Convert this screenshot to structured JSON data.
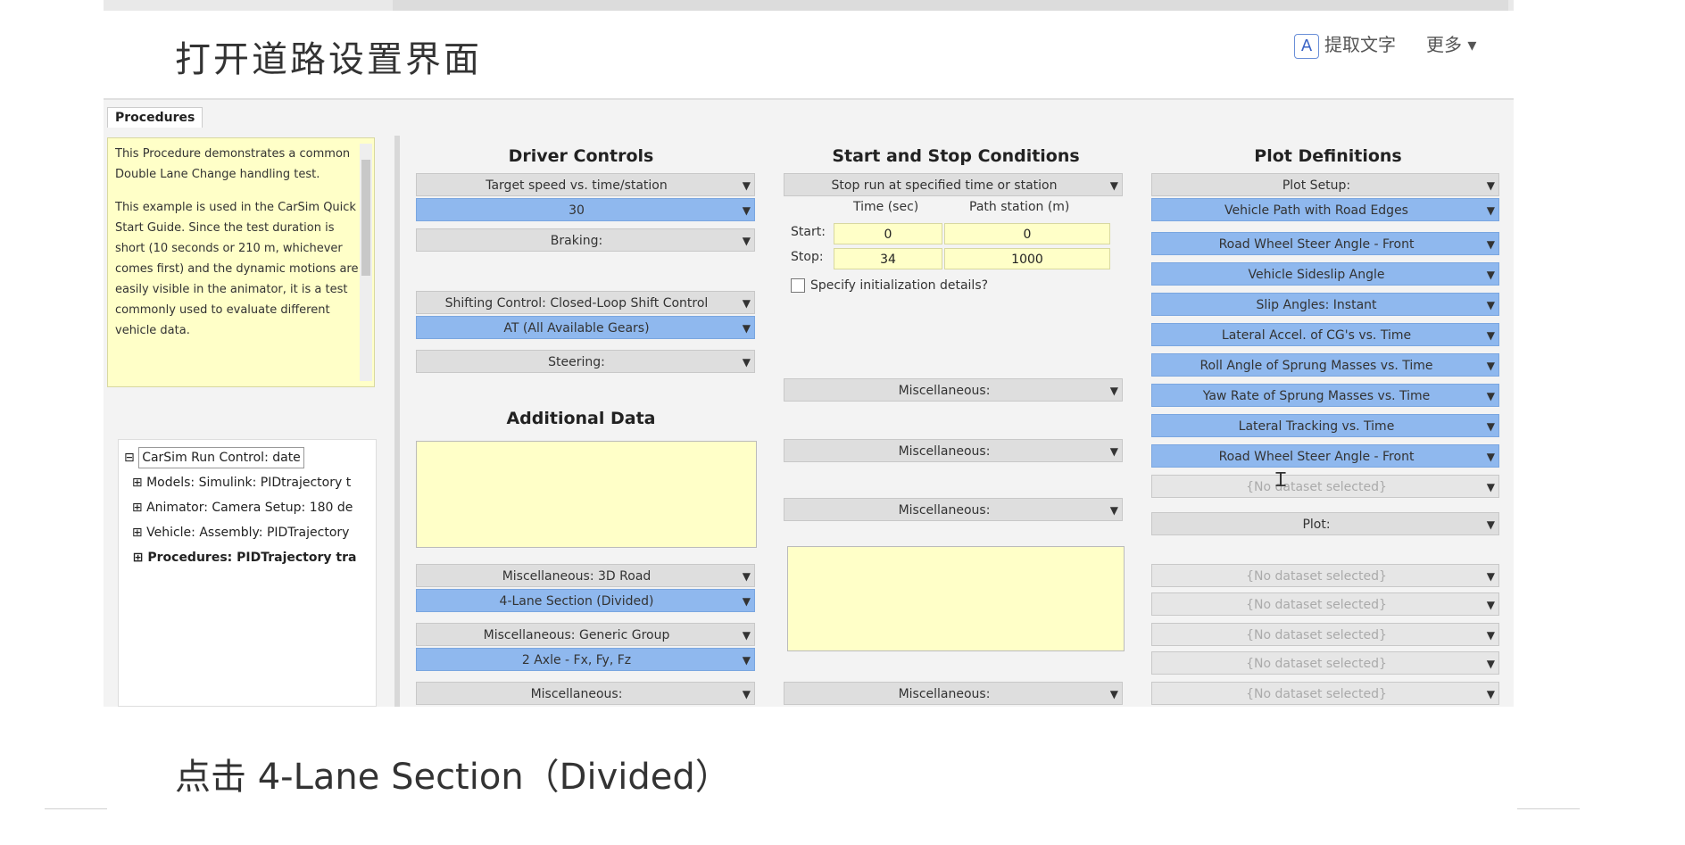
{
  "page": {
    "title": "打开道路设置界面",
    "caption": "点击 4-Lane Section（Divided）",
    "top_buttons": {
      "extract_text": "提取文字",
      "more": "更多"
    }
  },
  "left": {
    "tab": "Procedures",
    "notes": [
      "This Procedure demonstrates a common Double Lane Change handling test.",
      "This example is used in the CarSim Quick Start Guide. Since the test duration is short (10 seconds or 210 m, whichever comes first) and the dynamic motions are easily visible in the animator, it is a test commonly used to evaluate different vehicle data."
    ],
    "tree": {
      "root": "CarSim Run Control: date",
      "items": [
        "Models: Simulink: PIDtrajectory t",
        "Animator: Camera Setup: 180 de",
        "Vehicle: Assembly: PIDTrajectory",
        "Procedures: PIDTrajectory tra"
      ]
    }
  },
  "driver": {
    "title": "Driver Controls",
    "speed_mode": "Target speed vs. time/station",
    "speed_value": "30",
    "braking": "Braking:",
    "shifting": "Shifting Control: Closed-Loop Shift Control",
    "gears": "AT (All Available Gears)",
    "steering": "Steering:",
    "additional_title": "Additional Data",
    "misc_road": "Miscellaneous: 3D Road",
    "lane_section": "4-Lane Section (Divided)",
    "misc_generic": "Miscellaneous: Generic Group",
    "axle": "2 Axle - Fx, Fy, Fz",
    "misc_bottom": "Miscellaneous:"
  },
  "startstop": {
    "title": "Start and Stop Conditions",
    "mode": "Stop run at specified time or station",
    "col_time": "Time (sec)",
    "col_path": "Path station (m)",
    "start_label": "Start:",
    "stop_label": "Stop:",
    "start_time": "0",
    "start_path": "0",
    "stop_time": "34",
    "stop_path": "1000",
    "init_checkbox": "Specify initialization details?",
    "misc1": "Miscellaneous:",
    "misc2": "Miscellaneous:",
    "misc3": "Miscellaneous:",
    "misc4": "Miscellaneous:"
  },
  "plot": {
    "title": "Plot Definitions",
    "setup": "Plot Setup:",
    "items": [
      "Vehicle Path with Road Edges",
      "Road Wheel Steer Angle - Front",
      "Vehicle Sideslip Angle",
      "Slip Angles: Instant",
      "Lateral Accel. of CG's vs. Time",
      "Roll Angle of Sprung Masses vs. Time",
      "Yaw Rate of Sprung Masses vs. Time",
      "Lateral Tracking vs. Time",
      "Road Wheel Steer Angle - Front"
    ],
    "no_dataset": "{No dataset selected}",
    "plot_btn": "Plot:"
  }
}
